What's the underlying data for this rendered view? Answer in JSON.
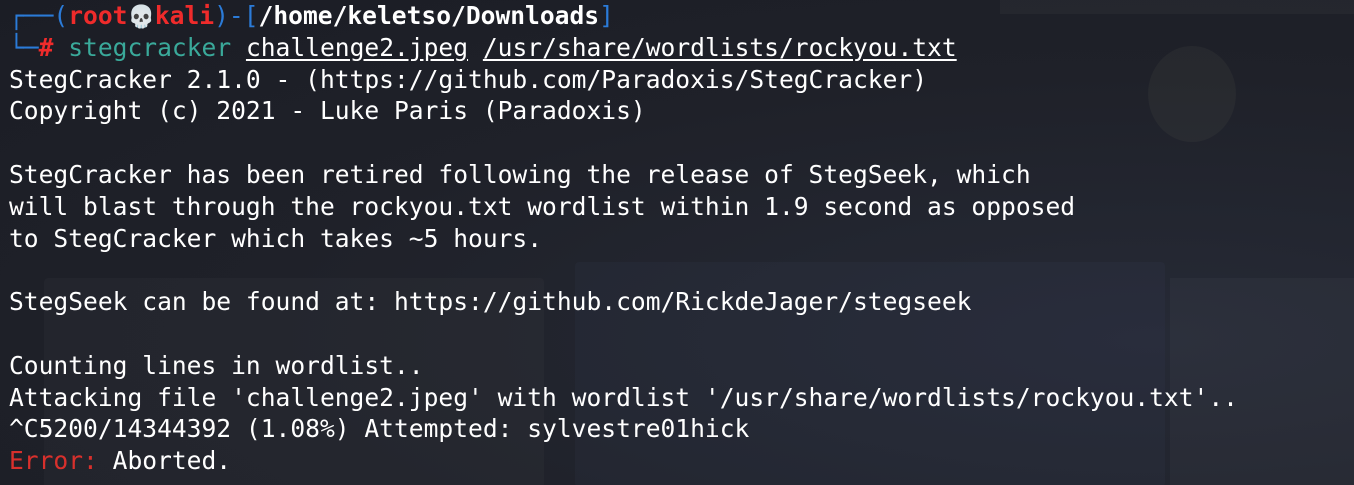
{
  "colors": {
    "background": "#1e2029",
    "prompt_frame": "#2b7bd8",
    "user_host": "#ef2b2b",
    "command": "#3aa99a",
    "error": "#d8302c",
    "text": "#ffffff"
  },
  "prompt": {
    "frame_top": "┌──(",
    "user": "root",
    "skull_icon": "💀",
    "host": "kali",
    "sep": ")-[",
    "cwd": "/home/keletso/Downloads",
    "close": "]",
    "frame_bottom": "└─",
    "hash": "#",
    "command": "stegcracker",
    "arg1": "challenge2.jpeg",
    "arg2": "/usr/share/wordlists/rockyou.txt"
  },
  "output": {
    "line1": "StegCracker 2.1.0 - (https://github.com/Paradoxis/StegCracker)",
    "line2": "Copyright (c) 2021 - Luke Paris (Paradoxis)",
    "line3": "StegCracker has been retired following the release of StegSeek, which",
    "line4": "will blast through the rockyou.txt wordlist within 1.9 second as opposed",
    "line5": "to StegCracker which takes ~5 hours.",
    "line6": "StegSeek can be found at: https://github.com/RickdeJager/stegseek",
    "line7": "Counting lines in wordlist..",
    "line8": "Attacking file 'challenge2.jpeg' with wordlist '/usr/share/wordlists/rockyou.txt'..",
    "line9": "^C5200/14344392 (1.08%) Attempted: sylvestre01hick",
    "error_label": "Error:",
    "error_message": " Aborted."
  }
}
